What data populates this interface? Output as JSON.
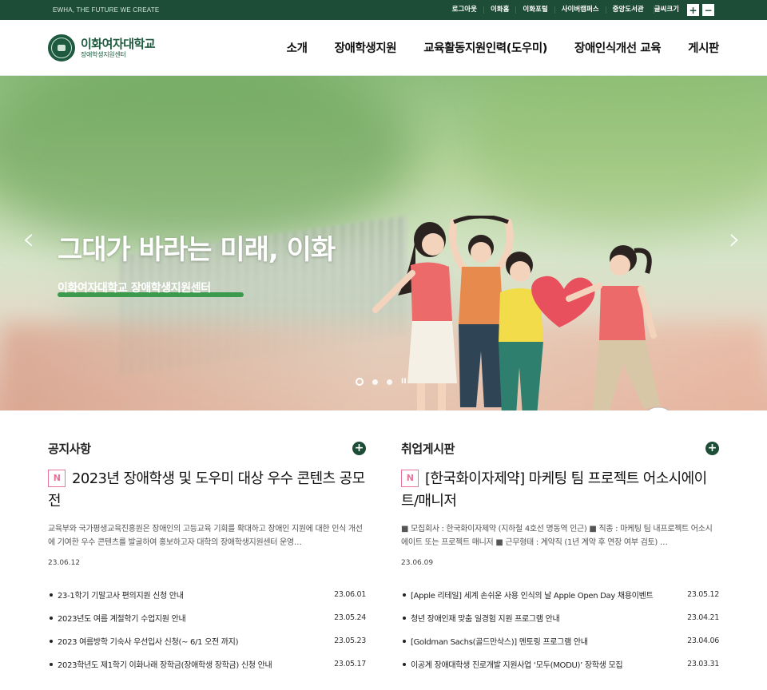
{
  "topbar": {
    "slogan": "EWHA, THE FUTURE WE CREATE",
    "links": [
      "로그아웃",
      "이화홈",
      "이화포털",
      "사이버캠퍼스",
      "중앙도서관"
    ],
    "font_size_label": "글씨크기",
    "plus": "+",
    "minus": "−"
  },
  "header": {
    "univ_name": "이화여자대학교",
    "center_name": "장애학생지원센터",
    "nav": [
      "소개",
      "장애학생지원",
      "교육활동지원인력(도우미)",
      "장애인식개선 교육",
      "게시판"
    ]
  },
  "hero": {
    "title": "그대가 바라는 미래, 이화",
    "subtitle": "이화여자대학교 장애학생지원센터",
    "prev": "‹",
    "next": "›",
    "pause": "II"
  },
  "notice": {
    "heading": "공지사항",
    "plus": "+",
    "badge": "N",
    "feature_title": "2023년 장애학생 및 도우미 대상 우수 콘텐츠 공모전",
    "feature_desc": "교육부와 국가평생교육진흥원은 장애인의 고등교육 기회를 확대하고 장애인 지원에 대한 인식 개선에 기여한 우수 콘텐츠를 발굴하여 홍보하고자 대학의 장애학생지원센터 운영…",
    "feature_date": "23.06.12",
    "items": [
      {
        "title": "23-1학기 기말고사 편의지원 신청 안내",
        "date": "23.06.01"
      },
      {
        "title": "2023년도 여름 계절학기 수업지원 안내",
        "date": "23.05.24"
      },
      {
        "title": "2023 여름방학 기숙사 우선입사 신청(~ 6/1 오전 까지)",
        "date": "23.05.23"
      },
      {
        "title": "2023학년도 제1학기 이화나래 장학금(장애학생 장학금) 신청 안내",
        "date": "23.05.17"
      }
    ]
  },
  "jobs": {
    "heading": "취업게시판",
    "plus": "+",
    "badge": "N",
    "feature_title": "[한국화이자제약] 마케팅 팀 프로젝트 어소시에이트/매니저",
    "feature_desc": "■ 모집회사 : 한국화이자제약 (지하철 4호선 명동역 인근) ■ 직종 : 마케팅 팀 내프로젝트 어소시에이트 또는 프로젝트 매니저 ■ 근무형태 : 계약직 (1년 계약 후 연장 여부 검토) …",
    "feature_date": "23.06.09",
    "items": [
      {
        "title": "[Apple 리테일] 세계 손쉬운 사용 인식의 날 Apple Open Day 채용이벤트",
        "date": "23.05.12"
      },
      {
        "title": "청년 장애인재 맞춤 일경험 지원 프로그램 안내",
        "date": "23.04.21"
      },
      {
        "title": "[Goldman Sachs(골드만삭스)] 멘토링 프로그램 안내",
        "date": "23.04.06"
      },
      {
        "title": "이공계 장애대학생 진로개발 지원사업 ‘모두(MODU)’ 장학생 모집",
        "date": "23.03.31"
      }
    ]
  }
}
